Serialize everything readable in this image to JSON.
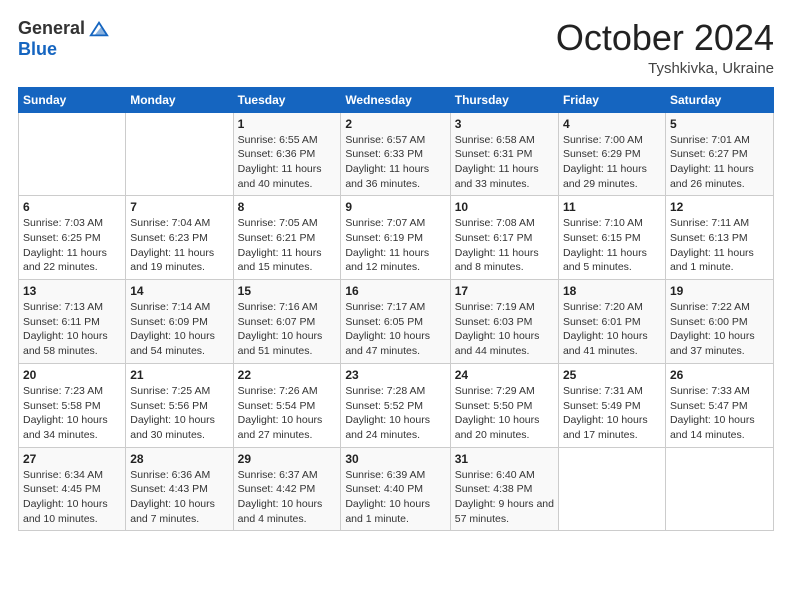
{
  "header": {
    "logo_general": "General",
    "logo_blue": "Blue",
    "month_year": "October 2024",
    "location": "Tyshkivka, Ukraine"
  },
  "weekdays": [
    "Sunday",
    "Monday",
    "Tuesday",
    "Wednesday",
    "Thursday",
    "Friday",
    "Saturday"
  ],
  "weeks": [
    [
      {
        "day": "",
        "sunrise": "",
        "sunset": "",
        "daylight": ""
      },
      {
        "day": "",
        "sunrise": "",
        "sunset": "",
        "daylight": ""
      },
      {
        "day": "1",
        "sunrise": "Sunrise: 6:55 AM",
        "sunset": "Sunset: 6:36 PM",
        "daylight": "Daylight: 11 hours and 40 minutes."
      },
      {
        "day": "2",
        "sunrise": "Sunrise: 6:57 AM",
        "sunset": "Sunset: 6:33 PM",
        "daylight": "Daylight: 11 hours and 36 minutes."
      },
      {
        "day": "3",
        "sunrise": "Sunrise: 6:58 AM",
        "sunset": "Sunset: 6:31 PM",
        "daylight": "Daylight: 11 hours and 33 minutes."
      },
      {
        "day": "4",
        "sunrise": "Sunrise: 7:00 AM",
        "sunset": "Sunset: 6:29 PM",
        "daylight": "Daylight: 11 hours and 29 minutes."
      },
      {
        "day": "5",
        "sunrise": "Sunrise: 7:01 AM",
        "sunset": "Sunset: 6:27 PM",
        "daylight": "Daylight: 11 hours and 26 minutes."
      }
    ],
    [
      {
        "day": "6",
        "sunrise": "Sunrise: 7:03 AM",
        "sunset": "Sunset: 6:25 PM",
        "daylight": "Daylight: 11 hours and 22 minutes."
      },
      {
        "day": "7",
        "sunrise": "Sunrise: 7:04 AM",
        "sunset": "Sunset: 6:23 PM",
        "daylight": "Daylight: 11 hours and 19 minutes."
      },
      {
        "day": "8",
        "sunrise": "Sunrise: 7:05 AM",
        "sunset": "Sunset: 6:21 PM",
        "daylight": "Daylight: 11 hours and 15 minutes."
      },
      {
        "day": "9",
        "sunrise": "Sunrise: 7:07 AM",
        "sunset": "Sunset: 6:19 PM",
        "daylight": "Daylight: 11 hours and 12 minutes."
      },
      {
        "day": "10",
        "sunrise": "Sunrise: 7:08 AM",
        "sunset": "Sunset: 6:17 PM",
        "daylight": "Daylight: 11 hours and 8 minutes."
      },
      {
        "day": "11",
        "sunrise": "Sunrise: 7:10 AM",
        "sunset": "Sunset: 6:15 PM",
        "daylight": "Daylight: 11 hours and 5 minutes."
      },
      {
        "day": "12",
        "sunrise": "Sunrise: 7:11 AM",
        "sunset": "Sunset: 6:13 PM",
        "daylight": "Daylight: 11 hours and 1 minute."
      }
    ],
    [
      {
        "day": "13",
        "sunrise": "Sunrise: 7:13 AM",
        "sunset": "Sunset: 6:11 PM",
        "daylight": "Daylight: 10 hours and 58 minutes."
      },
      {
        "day": "14",
        "sunrise": "Sunrise: 7:14 AM",
        "sunset": "Sunset: 6:09 PM",
        "daylight": "Daylight: 10 hours and 54 minutes."
      },
      {
        "day": "15",
        "sunrise": "Sunrise: 7:16 AM",
        "sunset": "Sunset: 6:07 PM",
        "daylight": "Daylight: 10 hours and 51 minutes."
      },
      {
        "day": "16",
        "sunrise": "Sunrise: 7:17 AM",
        "sunset": "Sunset: 6:05 PM",
        "daylight": "Daylight: 10 hours and 47 minutes."
      },
      {
        "day": "17",
        "sunrise": "Sunrise: 7:19 AM",
        "sunset": "Sunset: 6:03 PM",
        "daylight": "Daylight: 10 hours and 44 minutes."
      },
      {
        "day": "18",
        "sunrise": "Sunrise: 7:20 AM",
        "sunset": "Sunset: 6:01 PM",
        "daylight": "Daylight: 10 hours and 41 minutes."
      },
      {
        "day": "19",
        "sunrise": "Sunrise: 7:22 AM",
        "sunset": "Sunset: 6:00 PM",
        "daylight": "Daylight: 10 hours and 37 minutes."
      }
    ],
    [
      {
        "day": "20",
        "sunrise": "Sunrise: 7:23 AM",
        "sunset": "Sunset: 5:58 PM",
        "daylight": "Daylight: 10 hours and 34 minutes."
      },
      {
        "day": "21",
        "sunrise": "Sunrise: 7:25 AM",
        "sunset": "Sunset: 5:56 PM",
        "daylight": "Daylight: 10 hours and 30 minutes."
      },
      {
        "day": "22",
        "sunrise": "Sunrise: 7:26 AM",
        "sunset": "Sunset: 5:54 PM",
        "daylight": "Daylight: 10 hours and 27 minutes."
      },
      {
        "day": "23",
        "sunrise": "Sunrise: 7:28 AM",
        "sunset": "Sunset: 5:52 PM",
        "daylight": "Daylight: 10 hours and 24 minutes."
      },
      {
        "day": "24",
        "sunrise": "Sunrise: 7:29 AM",
        "sunset": "Sunset: 5:50 PM",
        "daylight": "Daylight: 10 hours and 20 minutes."
      },
      {
        "day": "25",
        "sunrise": "Sunrise: 7:31 AM",
        "sunset": "Sunset: 5:49 PM",
        "daylight": "Daylight: 10 hours and 17 minutes."
      },
      {
        "day": "26",
        "sunrise": "Sunrise: 7:33 AM",
        "sunset": "Sunset: 5:47 PM",
        "daylight": "Daylight: 10 hours and 14 minutes."
      }
    ],
    [
      {
        "day": "27",
        "sunrise": "Sunrise: 6:34 AM",
        "sunset": "Sunset: 4:45 PM",
        "daylight": "Daylight: 10 hours and 10 minutes."
      },
      {
        "day": "28",
        "sunrise": "Sunrise: 6:36 AM",
        "sunset": "Sunset: 4:43 PM",
        "daylight": "Daylight: 10 hours and 7 minutes."
      },
      {
        "day": "29",
        "sunrise": "Sunrise: 6:37 AM",
        "sunset": "Sunset: 4:42 PM",
        "daylight": "Daylight: 10 hours and 4 minutes."
      },
      {
        "day": "30",
        "sunrise": "Sunrise: 6:39 AM",
        "sunset": "Sunset: 4:40 PM",
        "daylight": "Daylight: 10 hours and 1 minute."
      },
      {
        "day": "31",
        "sunrise": "Sunrise: 6:40 AM",
        "sunset": "Sunset: 4:38 PM",
        "daylight": "Daylight: 9 hours and 57 minutes."
      },
      {
        "day": "",
        "sunrise": "",
        "sunset": "",
        "daylight": ""
      },
      {
        "day": "",
        "sunrise": "",
        "sunset": "",
        "daylight": ""
      }
    ]
  ]
}
